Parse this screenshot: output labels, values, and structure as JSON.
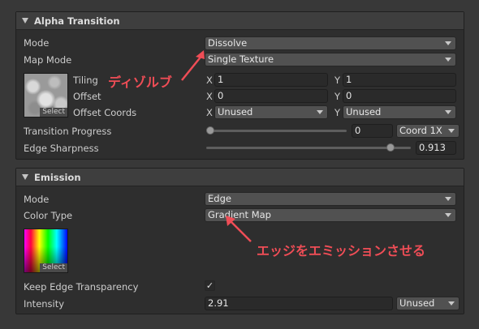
{
  "alpha": {
    "title": "Alpha Transition",
    "mode_label": "Mode",
    "mode_value": "Dissolve",
    "map_mode_label": "Map Mode",
    "map_mode_value": "Single Texture",
    "texture_select": "Select",
    "tiling_label": "Tiling",
    "tiling_x": "1",
    "tiling_y": "1",
    "offset_label": "Offset",
    "offset_x": "0",
    "offset_y": "0",
    "offset_coords_label": "Offset Coords",
    "offset_coords_x": "Unused",
    "offset_coords_y": "Unused",
    "axis_x": "X",
    "axis_y": "Y",
    "progress_label": "Transition Progress",
    "progress_value": "0",
    "progress_fraction": 0,
    "progress_coord": "Coord 1X",
    "sharpness_label": "Edge Sharpness",
    "sharpness_value": "0.913",
    "sharpness_fraction": 0.913
  },
  "emission": {
    "title": "Emission",
    "mode_label": "Mode",
    "mode_value": "Edge",
    "color_type_label": "Color Type",
    "color_type_value": "Gradient Map",
    "texture_select": "Select",
    "keep_edge_label": "Keep Edge Transparency",
    "keep_edge_checked": true,
    "intensity_label": "Intensity",
    "intensity_value": "2.91",
    "intensity_coord": "Unused"
  },
  "annotations": {
    "dissolve_note": "ディゾルブ",
    "emission_note": "エッジをエミッションさせる",
    "color": "#ef4d56"
  },
  "icons": {
    "check": "✓"
  }
}
